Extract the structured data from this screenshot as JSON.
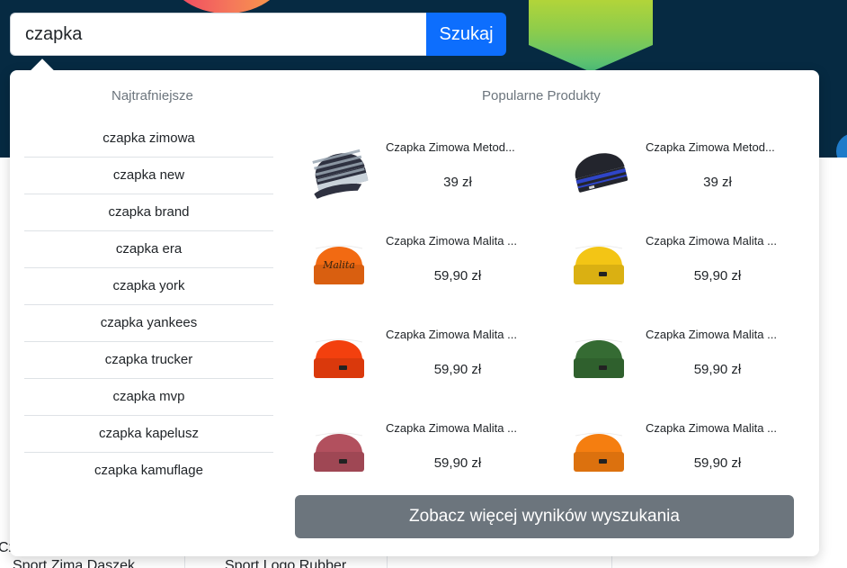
{
  "search": {
    "value": "czapka",
    "button_label": "Szukaj"
  },
  "dropdown": {
    "suggestions_title": "Najtrafniejsze",
    "products_title": "Popularne Produkty",
    "suggestions": [
      "czapka zimowa",
      "czapka new",
      "czapka brand",
      "czapka era",
      "czapka york",
      "czapka yankees",
      "czapka trucker",
      "czapka mvp",
      "czapka kapelusz",
      "czapka kamuflage"
    ],
    "products": [
      {
        "name": "Czapka Zimowa Metod...",
        "price": "39 zł",
        "color": "#2e3140",
        "accent": "#9aa7b3",
        "style": "stripe-visor"
      },
      {
        "name": "Czapka Zimowa Metod...",
        "price": "39 zł",
        "color": "#23252d",
        "accent": "#2f45c8",
        "style": "stripe"
      },
      {
        "name": "Czapka Zimowa Malita ...",
        "price": "59,90 zł",
        "color": "#f26a12",
        "accent": "#3a2510",
        "style": "script"
      },
      {
        "name": "Czapka Zimowa Malita ...",
        "price": "59,90 zł",
        "color": "#f3c515",
        "accent": "#222222",
        "style": "cuff"
      },
      {
        "name": "Czapka Zimowa Malita ...",
        "price": "59,90 zł",
        "color": "#f3400e",
        "accent": "#222222",
        "style": "cuff"
      },
      {
        "name": "Czapka Zimowa Malita ...",
        "price": "59,90 zł",
        "color": "#356b33",
        "accent": "#222222",
        "style": "cuff"
      },
      {
        "name": "Czapka Zimowa Malita ...",
        "price": "59,90 zł",
        "color": "#b2505e",
        "accent": "#222222",
        "style": "cuff"
      },
      {
        "name": "Czapka Zimowa Malita ...",
        "price": "59,90 zł",
        "color": "#f57e10",
        "accent": "#222222",
        "style": "cuff"
      }
    ],
    "more_button_label": "Zobacz więcej wyników wyszukania"
  },
  "background": {
    "card_titles": [
      "Sport Zima Daszek",
      "Sport Logo Rubber"
    ],
    "card_prefix": "Cz"
  },
  "colors": {
    "hero": "#062a42",
    "primary": "#0d6efd",
    "secondary": "#6c757d"
  }
}
